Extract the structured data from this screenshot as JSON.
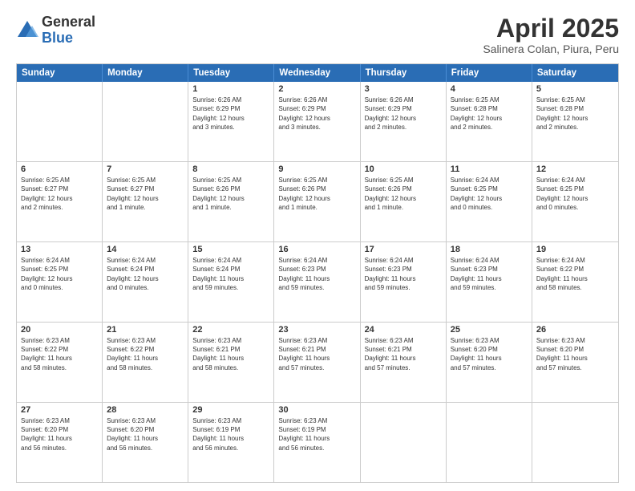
{
  "logo": {
    "general": "General",
    "blue": "Blue"
  },
  "header": {
    "title": "April 2025",
    "subtitle": "Salinera Colan, Piura, Peru"
  },
  "weekdays": [
    "Sunday",
    "Monday",
    "Tuesday",
    "Wednesday",
    "Thursday",
    "Friday",
    "Saturday"
  ],
  "weeks": [
    [
      {
        "day": "",
        "info": ""
      },
      {
        "day": "",
        "info": ""
      },
      {
        "day": "1",
        "info": "Sunrise: 6:26 AM\nSunset: 6:29 PM\nDaylight: 12 hours\nand 3 minutes."
      },
      {
        "day": "2",
        "info": "Sunrise: 6:26 AM\nSunset: 6:29 PM\nDaylight: 12 hours\nand 3 minutes."
      },
      {
        "day": "3",
        "info": "Sunrise: 6:26 AM\nSunset: 6:29 PM\nDaylight: 12 hours\nand 2 minutes."
      },
      {
        "day": "4",
        "info": "Sunrise: 6:25 AM\nSunset: 6:28 PM\nDaylight: 12 hours\nand 2 minutes."
      },
      {
        "day": "5",
        "info": "Sunrise: 6:25 AM\nSunset: 6:28 PM\nDaylight: 12 hours\nand 2 minutes."
      }
    ],
    [
      {
        "day": "6",
        "info": "Sunrise: 6:25 AM\nSunset: 6:27 PM\nDaylight: 12 hours\nand 2 minutes."
      },
      {
        "day": "7",
        "info": "Sunrise: 6:25 AM\nSunset: 6:27 PM\nDaylight: 12 hours\nand 1 minute."
      },
      {
        "day": "8",
        "info": "Sunrise: 6:25 AM\nSunset: 6:26 PM\nDaylight: 12 hours\nand 1 minute."
      },
      {
        "day": "9",
        "info": "Sunrise: 6:25 AM\nSunset: 6:26 PM\nDaylight: 12 hours\nand 1 minute."
      },
      {
        "day": "10",
        "info": "Sunrise: 6:25 AM\nSunset: 6:26 PM\nDaylight: 12 hours\nand 1 minute."
      },
      {
        "day": "11",
        "info": "Sunrise: 6:24 AM\nSunset: 6:25 PM\nDaylight: 12 hours\nand 0 minutes."
      },
      {
        "day": "12",
        "info": "Sunrise: 6:24 AM\nSunset: 6:25 PM\nDaylight: 12 hours\nand 0 minutes."
      }
    ],
    [
      {
        "day": "13",
        "info": "Sunrise: 6:24 AM\nSunset: 6:25 PM\nDaylight: 12 hours\nand 0 minutes."
      },
      {
        "day": "14",
        "info": "Sunrise: 6:24 AM\nSunset: 6:24 PM\nDaylight: 12 hours\nand 0 minutes."
      },
      {
        "day": "15",
        "info": "Sunrise: 6:24 AM\nSunset: 6:24 PM\nDaylight: 11 hours\nand 59 minutes."
      },
      {
        "day": "16",
        "info": "Sunrise: 6:24 AM\nSunset: 6:23 PM\nDaylight: 11 hours\nand 59 minutes."
      },
      {
        "day": "17",
        "info": "Sunrise: 6:24 AM\nSunset: 6:23 PM\nDaylight: 11 hours\nand 59 minutes."
      },
      {
        "day": "18",
        "info": "Sunrise: 6:24 AM\nSunset: 6:23 PM\nDaylight: 11 hours\nand 59 minutes."
      },
      {
        "day": "19",
        "info": "Sunrise: 6:24 AM\nSunset: 6:22 PM\nDaylight: 11 hours\nand 58 minutes."
      }
    ],
    [
      {
        "day": "20",
        "info": "Sunrise: 6:23 AM\nSunset: 6:22 PM\nDaylight: 11 hours\nand 58 minutes."
      },
      {
        "day": "21",
        "info": "Sunrise: 6:23 AM\nSunset: 6:22 PM\nDaylight: 11 hours\nand 58 minutes."
      },
      {
        "day": "22",
        "info": "Sunrise: 6:23 AM\nSunset: 6:21 PM\nDaylight: 11 hours\nand 58 minutes."
      },
      {
        "day": "23",
        "info": "Sunrise: 6:23 AM\nSunset: 6:21 PM\nDaylight: 11 hours\nand 57 minutes."
      },
      {
        "day": "24",
        "info": "Sunrise: 6:23 AM\nSunset: 6:21 PM\nDaylight: 11 hours\nand 57 minutes."
      },
      {
        "day": "25",
        "info": "Sunrise: 6:23 AM\nSunset: 6:20 PM\nDaylight: 11 hours\nand 57 minutes."
      },
      {
        "day": "26",
        "info": "Sunrise: 6:23 AM\nSunset: 6:20 PM\nDaylight: 11 hours\nand 57 minutes."
      }
    ],
    [
      {
        "day": "27",
        "info": "Sunrise: 6:23 AM\nSunset: 6:20 PM\nDaylight: 11 hours\nand 56 minutes."
      },
      {
        "day": "28",
        "info": "Sunrise: 6:23 AM\nSunset: 6:20 PM\nDaylight: 11 hours\nand 56 minutes."
      },
      {
        "day": "29",
        "info": "Sunrise: 6:23 AM\nSunset: 6:19 PM\nDaylight: 11 hours\nand 56 minutes."
      },
      {
        "day": "30",
        "info": "Sunrise: 6:23 AM\nSunset: 6:19 PM\nDaylight: 11 hours\nand 56 minutes."
      },
      {
        "day": "",
        "info": ""
      },
      {
        "day": "",
        "info": ""
      },
      {
        "day": "",
        "info": ""
      }
    ]
  ]
}
